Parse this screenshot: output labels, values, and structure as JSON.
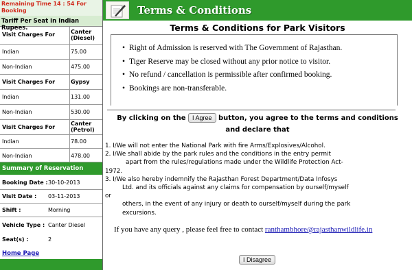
{
  "sidebar": {
    "timer": "Remaining Time 14 : 54 For Booking",
    "tariff_title": "Tariff Per Seat in Indian Rupees.",
    "tariffs": [
      {
        "header": "Visit Charges For",
        "vehicle": "Canter (Diesel)",
        "indian": "75.00",
        "non_indian": "475.00"
      },
      {
        "header": "Visit Charges For",
        "vehicle": "Gypsy",
        "indian": "131.00",
        "non_indian": "530.00"
      },
      {
        "header": "Visit Charges For",
        "vehicle": "Canter (Petrol)",
        "indian": "78.00",
        "non_indian": "478.00"
      }
    ],
    "labels": {
      "indian": "Indian",
      "non_indian": "Non-Indian"
    },
    "summary_title": "Summary of Reservation",
    "summary": {
      "booking_date_label": "Booking Date :",
      "booking_date": "30-10-2013",
      "visit_date_label": "Visit Date :",
      "visit_date": "03-11-2013",
      "shift_label": "Shift :",
      "shift": "Morning",
      "vehicle_type_label": "Vehicle Type :",
      "vehicle_type": "Canter Diesel",
      "seats_label": "Seat(s) :",
      "seats": "2"
    },
    "home_link": "Home Page"
  },
  "main": {
    "banner_title": "Terms & Conditions",
    "page_title": "Terms & Conditions for Park Visitors",
    "rules": [
      "Right of Admission is reserved with The Government of Rajasthan.",
      "Tiger Reserve may be closed without any prior notice to visitor.",
      "No refund / cancellation is permissible after confirmed booking.",
      "Bookings are non-transferable."
    ],
    "agree_prefix": "By clicking on the",
    "agree_button": "I Agree",
    "agree_suffix": "button, you agree to the terms and conditions",
    "agree_line2": "and declare that",
    "declarations": [
      "1. I/We will not enter the National Park with fire Arms/Explosives/Alcohol.",
      "2. I/We shall abide by the park rules and the conditions in the entry permit",
      "apart  from the rules/regulations made under the Wildlife Protection Act-",
      "1972.",
      "3. I/We also hereby indemnify the Rajasthan Forest Department/Data Infosys",
      "Ltd. and its officials against any claims for compensation by ourself/myself",
      "or",
      "others, in the event of any injury or death to ourself/myself during the park",
      "excursions."
    ],
    "query_text": "If you have any query , please feel free to contact",
    "query_email": "ranthambhore@rajasthanwildlife.in",
    "disagree_button": "I Disagree"
  }
}
